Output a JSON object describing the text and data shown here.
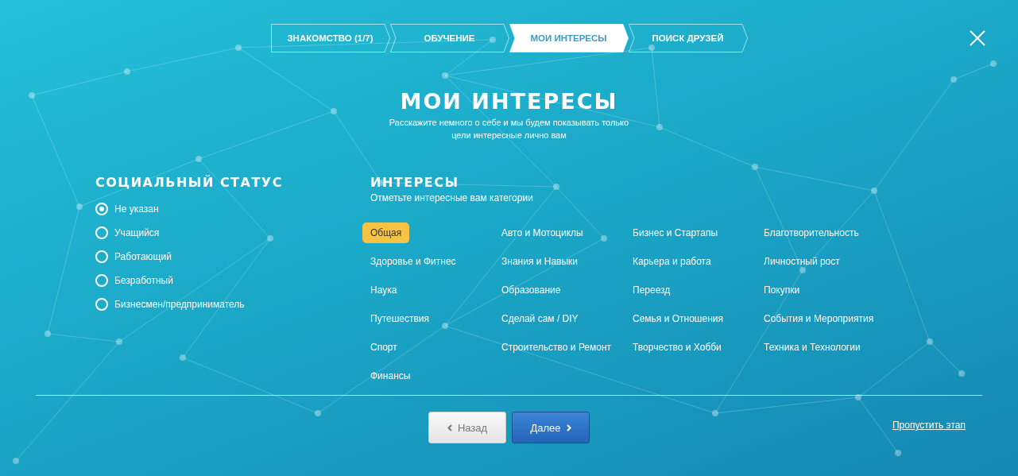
{
  "steps": [
    {
      "label": "ЗНАКОМСТВО (1/7)",
      "selected": false
    },
    {
      "label": "ОБУЧЕНИЕ",
      "selected": false
    },
    {
      "label": "МОИ ИНТЕРЕСЫ",
      "selected": true
    },
    {
      "label": "ПОИСК ДРУЗЕЙ",
      "selected": false
    }
  ],
  "title": "МОИ ИНТЕРЕСЫ",
  "subtitle": [
    "Расскажите немного о себе и мы будем показывать только",
    "цели интересные лично вам"
  ],
  "social_status": {
    "heading": "СОЦИАЛЬНЫЙ СТАТУС",
    "options": [
      {
        "label": "Не указан",
        "selected": true
      },
      {
        "label": "Учащийся",
        "selected": false
      },
      {
        "label": "Работающий",
        "selected": false
      },
      {
        "label": "Безработный",
        "selected": false
      },
      {
        "label": "Бизнесмен/предприниматель",
        "selected": false
      }
    ]
  },
  "interests": {
    "heading": "ИНТЕРЕСЫ",
    "hint": "Отметьте интересные вам категории",
    "categories": [
      {
        "label": "Общая",
        "selected": true
      },
      {
        "label": "Авто и Мотоциклы",
        "selected": false
      },
      {
        "label": "Бизнес и Стартапы",
        "selected": false
      },
      {
        "label": "Благотворительность",
        "selected": false
      },
      {
        "label": "Здоровье и Фитнес",
        "selected": false
      },
      {
        "label": "Знания и Навыки",
        "selected": false
      },
      {
        "label": "Карьера и работа",
        "selected": false
      },
      {
        "label": "Личностный рост",
        "selected": false
      },
      {
        "label": "Наука",
        "selected": false
      },
      {
        "label": "Образование",
        "selected": false
      },
      {
        "label": "Переезд",
        "selected": false
      },
      {
        "label": "Покупки",
        "selected": false
      },
      {
        "label": "Путешествия",
        "selected": false
      },
      {
        "label": "Сделай сам / DIY",
        "selected": false
      },
      {
        "label": "Семья и Отношения",
        "selected": false
      },
      {
        "label": "События и Мероприятия",
        "selected": false
      },
      {
        "label": "Спорт",
        "selected": false
      },
      {
        "label": "Строительство и Ремонт",
        "selected": false
      },
      {
        "label": "Творчество и Хобби",
        "selected": false
      },
      {
        "label": "Техника и Технологии",
        "selected": false
      },
      {
        "label": "Финансы",
        "selected": false
      }
    ]
  },
  "buttons": {
    "back": "Назад",
    "next": "Далее",
    "skip": "Пропустить этап"
  }
}
